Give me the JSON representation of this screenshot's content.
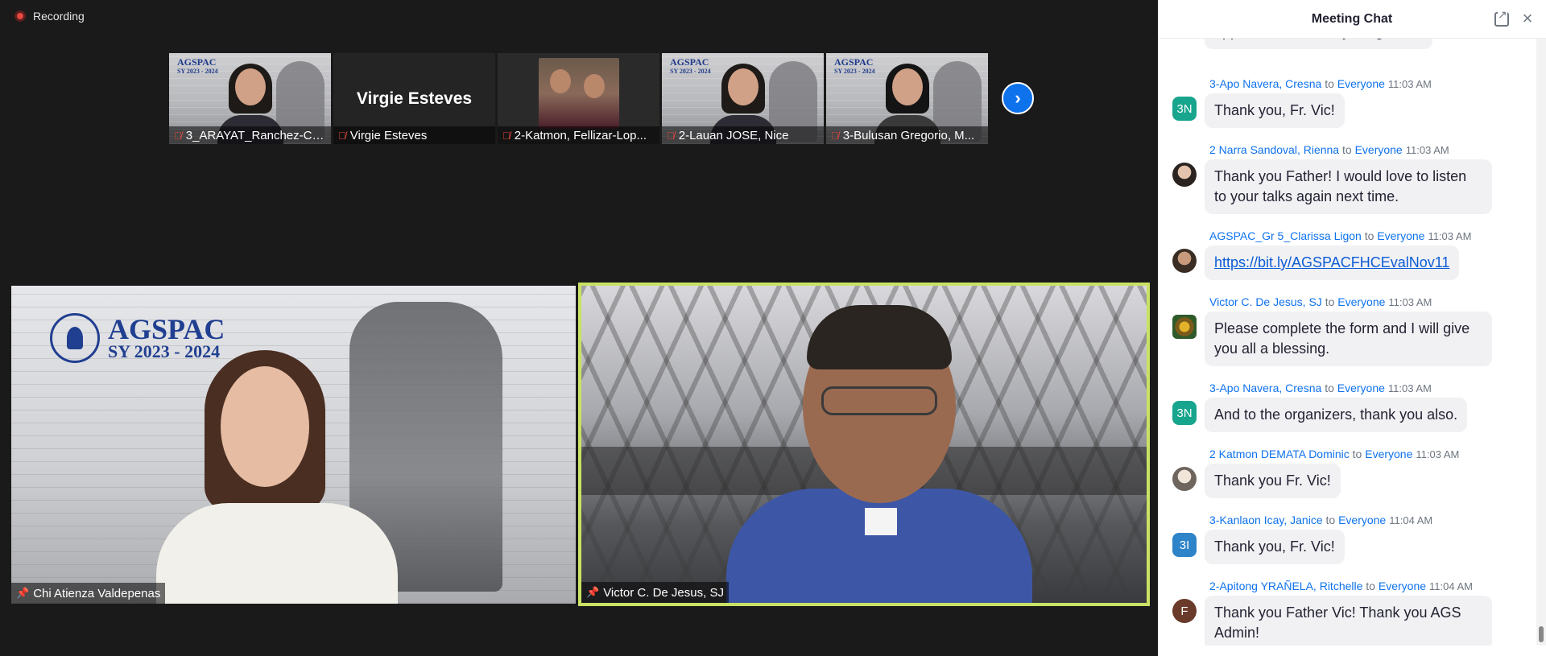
{
  "recording": {
    "label": "Recording"
  },
  "gallery": {
    "thumbnails": [
      {
        "name": "3_ARAYAT_Ranchez-Ca..."
      },
      {
        "name": "Virgie Esteves",
        "display_text": "Virgie Esteves"
      },
      {
        "name": "2-Katmon, Fellizar-Lop..."
      },
      {
        "name": "2-Lauan JOSE, Nice"
      },
      {
        "name": "3-Bulusan Gregorio, M..."
      }
    ],
    "logo_line1": "AGSPAC",
    "logo_line2": "SY 2023 - 2024"
  },
  "main_tiles": {
    "left": {
      "name": "Chi Atienza Valdepenas",
      "logo_line1": "AGSPAC",
      "logo_line2": "SY 2023 - 2024"
    },
    "right": {
      "name": "Victor C. De Jesus, SJ"
    }
  },
  "chat": {
    "title": "Meeting Chat",
    "partial_message": "appreciated and very insightful...",
    "to_word": "to",
    "messages": [
      {
        "sender": "3-Apo Navera,  Cresna",
        "recipient": "Everyone",
        "time": "11:03 AM",
        "avatar": "3N",
        "text": "Thank you, Fr. Vic!"
      },
      {
        "sender": "2 Narra Sandoval, Rienna",
        "recipient": "Everyone",
        "time": "11:03 AM",
        "avatar": "",
        "text": "Thank you Father! I would love to listen to your talks again next time."
      },
      {
        "sender": "AGSPAC_Gr 5_Clarissa Ligon",
        "recipient": "Everyone",
        "time": "11:03 AM",
        "avatar": "",
        "text": "https://bit.ly/AGSPACFHCEvalNov11"
      },
      {
        "sender": "Victor C. De Jesus, SJ",
        "recipient": "Everyone",
        "time": "11:03 AM",
        "avatar": "",
        "text": "Please complete the form and I will give you all a blessing."
      },
      {
        "sender": "3-Apo Navera,  Cresna",
        "recipient": "Everyone",
        "time": "11:03 AM",
        "avatar": "3N",
        "text": "And to the organizers, thank you also."
      },
      {
        "sender": "2 Katmon DEMATA Dominic",
        "recipient": "Everyone",
        "time": "11:03 AM",
        "avatar": "",
        "text": "Thank you Fr. Vic!"
      },
      {
        "sender": "3-Kanlaon Icay, Janice",
        "recipient": "Everyone",
        "time": "11:04 AM",
        "avatar": "3I",
        "text": "Thank you, Fr. Vic!"
      },
      {
        "sender": "2-Apitong YRAÑELA, Ritchelle",
        "recipient": "Everyone",
        "time": "11:04 AM",
        "avatar": "F",
        "text": "Thank you Father Vic! Thank you AGS Admin!"
      }
    ]
  },
  "colors": {
    "accent": "#0e72ed",
    "active_speaker_border": "#c9e265",
    "recording_red": "#e5483f"
  }
}
